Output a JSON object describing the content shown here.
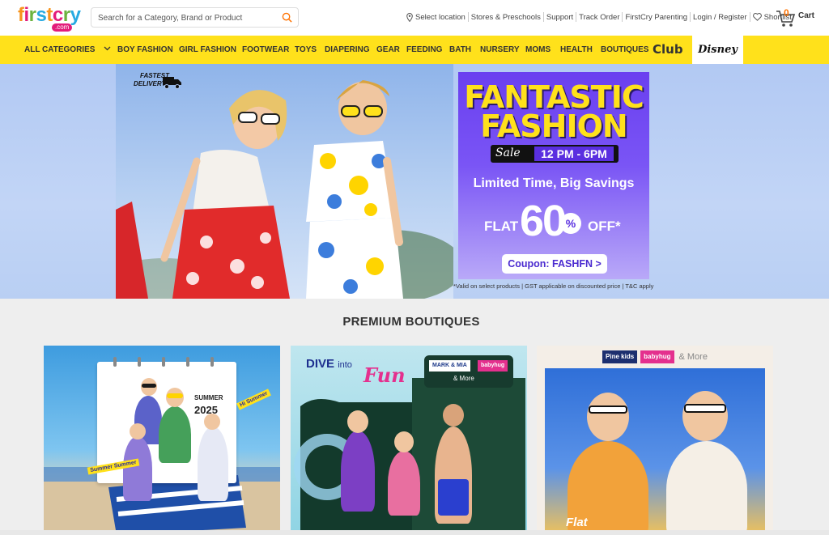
{
  "header": {
    "logo_text": "firstcry",
    "logo_sub": ".com",
    "search_placeholder": "Search for a Category, Brand or Product",
    "links": {
      "location": "Select location",
      "stores": "Stores & Preschools",
      "support": "Support",
      "track": "Track Order",
      "parenting": "FirstCry Parenting",
      "login": "Login / Register",
      "shortlist": "Shortlist"
    },
    "cart_label": "Cart",
    "cart_count": "0"
  },
  "nav": {
    "all_categories": "ALL CATEGORIES",
    "items": [
      "BOY FASHION",
      "GIRL FASHION",
      "FOOTWEAR",
      "TOYS",
      "DIAPERING",
      "GEAR",
      "FEEDING",
      "BATH",
      "NURSERY",
      "MOMS",
      "HEALTH",
      "BOUTIQUES"
    ],
    "club": "Club",
    "disney": "Disney"
  },
  "hero": {
    "badge_line1": "FASTEST",
    "badge_line2": "DELIVERY",
    "headline_line1": "FANTASTIC",
    "headline_line2": "FASHION",
    "sale_word": "Sale",
    "sale_time": "12 PM - 6PM",
    "tagline": "Limited Time, Big Savings",
    "flat": "FLAT",
    "discount": "60",
    "percent": "%",
    "off": "OFF*",
    "coupon": "Coupon: FASHFN >",
    "disclaimer": "*Valid on select products | GST applicable on discounted price | T&C apply"
  },
  "boutiques": {
    "title": "PREMIUM BOUTIQUES",
    "card1": {
      "summer": "SUMMER",
      "year": "2025",
      "tag1": "Summer Summer",
      "tag2": "Hi Summer"
    },
    "card2": {
      "dive": "DIVE",
      "into": "into",
      "fun": "Fun",
      "brand1": "MARK & MIA",
      "brand2": "babyhug",
      "more": "& More"
    },
    "card3": {
      "brand1": "Pine kids",
      "brand2": "babyhug",
      "more": "& More",
      "flat": "Flat"
    }
  },
  "colors": {
    "brand_yellow": "#ffe11b",
    "promo_purple": "#6a3ff0",
    "accent_orange": "#ff7200",
    "pink": "#e31c7a"
  }
}
